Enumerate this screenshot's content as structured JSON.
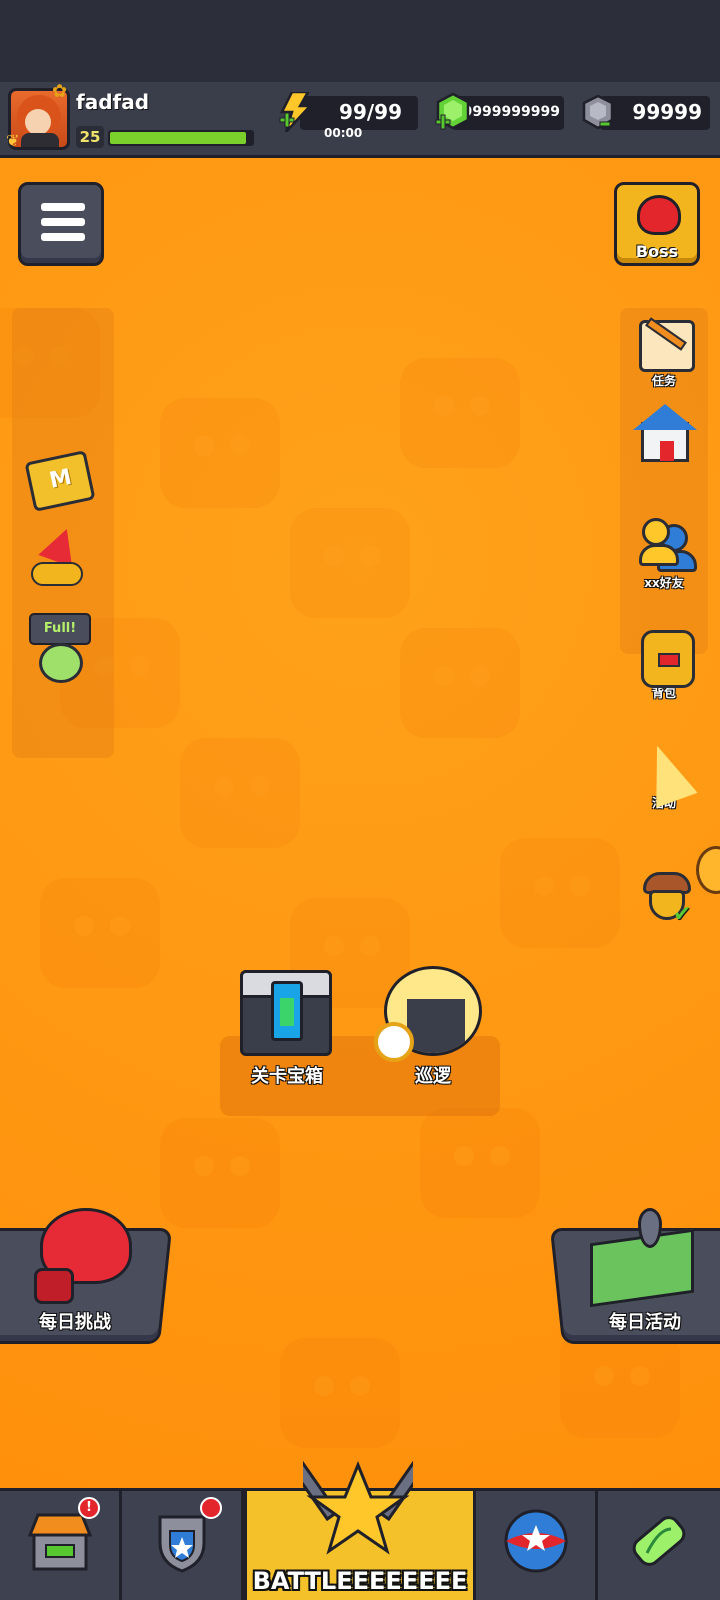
{
  "player": {
    "name": "fadfad",
    "level": "25",
    "xp_progress": 0.96
  },
  "resources": {
    "energy": {
      "value": "99/99",
      "timer": "00:00",
      "icon": "lightning-bolt-icon"
    },
    "gems": {
      "value": "9999999999",
      "icon": "green-gem-icon"
    },
    "stones": {
      "value": "99999",
      "icon": "gray-stone-icon"
    }
  },
  "top_buttons": {
    "menu": {
      "icon": "list-menu-icon"
    },
    "boss": {
      "label": "Boss",
      "icon": "red-demon-icon"
    }
  },
  "left_side": [
    {
      "id": "monthly-card",
      "icon": "m-card-icon",
      "label": "M"
    },
    {
      "id": "growth-fund",
      "icon": "gems-coins-arrow-icon"
    },
    {
      "id": "full-potion",
      "icon": "green-potion-icon",
      "tag": "Full!"
    }
  ],
  "right_side": [
    {
      "id": "tasks",
      "icon": "scroll-pencil-icon",
      "label": "任务"
    },
    {
      "id": "home",
      "icon": "house-icon",
      "label": ""
    },
    {
      "id": "friends",
      "icon": "friends-icon",
      "label": "xx好友"
    },
    {
      "id": "backpack",
      "icon": "backpack-icon",
      "label": "背包"
    },
    {
      "id": "events",
      "icon": "party-popper-icon",
      "label": "活动"
    },
    {
      "id": "acorn",
      "icon": "acorn-check-icon",
      "label": ""
    }
  ],
  "center": {
    "chest": {
      "label": "关卡宝箱",
      "icon": "stage-chest-icon"
    },
    "patrol": {
      "label": "巡逻",
      "icon": "patrol-clock-icon"
    }
  },
  "corners": {
    "daily_challenge": {
      "label": "每日挑战",
      "icon": "boxing-glove-icon"
    },
    "daily_event": {
      "label": "每日活动",
      "icon": "map-pin-icon"
    }
  },
  "bottom_nav": [
    {
      "id": "shop",
      "icon": "shop-stall-icon",
      "badge": "!"
    },
    {
      "id": "shield",
      "icon": "shield-icon",
      "badge": ""
    },
    {
      "id": "battle",
      "icon": "star-crossed-swords-icon",
      "label": "BATTLEEEEEEEE",
      "active": true
    },
    {
      "id": "orbs",
      "icon": "star-ball-icon"
    },
    {
      "id": "dna",
      "icon": "dna-capsule-icon"
    }
  ],
  "colors": {
    "orange_bg": "#ff9a14",
    "dark_ui": "#3a3d4a",
    "active_tab": "#f5c12a",
    "xp_green": "#7bd02b",
    "badge_red": "#e3262c"
  }
}
